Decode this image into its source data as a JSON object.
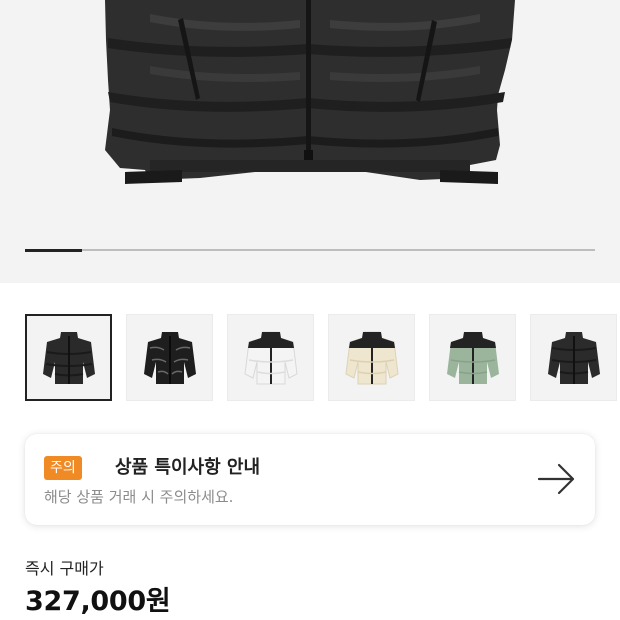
{
  "gallery": {
    "main_image": "black-puffer-jacket-closeup",
    "progress_fraction": 0.1,
    "thumbnails": [
      {
        "name": "black-matte-puffer",
        "selected": true
      },
      {
        "name": "black-glossy-puffer",
        "selected": false
      },
      {
        "name": "white-black-puffer",
        "selected": false
      },
      {
        "name": "cream-black-puffer",
        "selected": false
      },
      {
        "name": "sage-black-puffer",
        "selected": false
      },
      {
        "name": "all-black-puffer",
        "selected": false
      }
    ]
  },
  "notice": {
    "badge": "주의",
    "title": "상품 특이사항 안내",
    "subtitle": "해당 상품 거래 시 주의하세요.",
    "arrow_icon": "arrow-right-icon"
  },
  "price": {
    "label": "즉시 구매가",
    "value": "327,000원"
  },
  "colors": {
    "accent": "#f08a24",
    "hero_bg": "#f3f3f3",
    "text": "#222222",
    "muted": "#8c8c8c"
  }
}
